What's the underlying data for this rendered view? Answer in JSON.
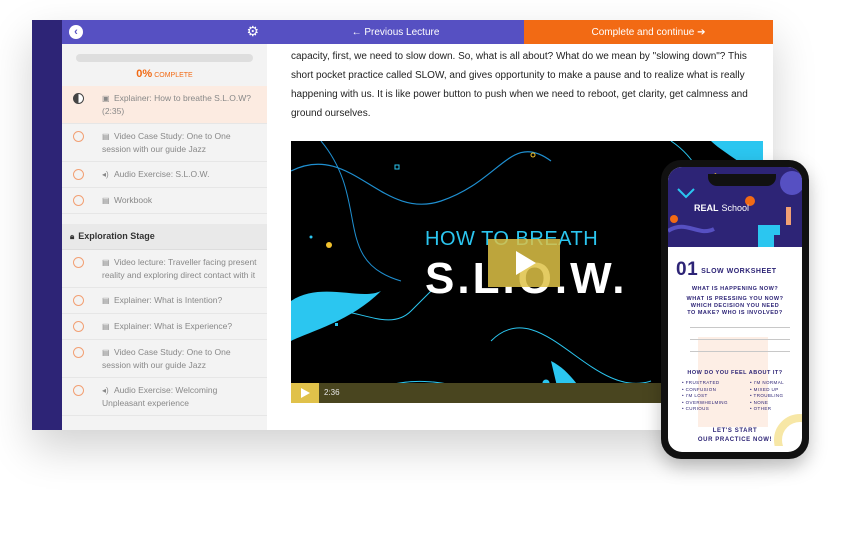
{
  "sidebar": {
    "progress_pct": "0%",
    "progress_label": "COMPLETE",
    "lessons_top": [
      {
        "icon": "video-icon",
        "label": "Explainer: How to breathe S.L.O.W? (2:35)",
        "active": true
      },
      {
        "icon": "doc-icon",
        "label": "Video Case Study: One to One session with our guide Jazz"
      },
      {
        "icon": "audio-icon",
        "label": "Audio Exercise: S.L.O.W."
      },
      {
        "icon": "doc-icon",
        "label": "Workbook"
      }
    ],
    "stage_title": "Exploration Stage",
    "lessons_stage": [
      {
        "icon": "doc-icon",
        "label": "Video lecture: Traveller facing present reality and exploring direct contact with it"
      },
      {
        "icon": "doc-icon",
        "label": "Explainer: What is Intention?"
      },
      {
        "icon": "doc-icon",
        "label": "Explainer: What is Experience?"
      },
      {
        "icon": "doc-icon",
        "label": "Video Case Study: One to One session with our guide Jazz"
      },
      {
        "icon": "audio-icon",
        "label": "Audio Exercise: Welcoming Unpleasant experience"
      }
    ]
  },
  "nav": {
    "prev_label": "← Previous Lecture",
    "next_label": "Complete and continue ➔"
  },
  "content": {
    "paragraph": "capacity, first, we need to slow down. So, what is all about? What do we mean by \"slowing down\"? This short pocket practice called SLOW, and gives opportunity to make a pause and to realize what is really happening with us. It is like power button to push when we need to reboot, get clarity, get calmness and ground ourselves."
  },
  "video": {
    "title_line1": "HOW TO BREATH",
    "title_line2": "S.L.O.W.",
    "time": "2:36"
  },
  "phone": {
    "brand_bold": "REAL",
    "brand_rest": "School",
    "number": "01",
    "sheet_title": "SLOW WORKSHEET",
    "q1": "WHAT IS HAPPENING NOW?",
    "q2": "WHAT IS PRESSING YOU NOW? WHICH DECISION YOU NEED TO MAKE? WHO IS INVOLVED?",
    "q3": "HOW DO YOU FEEL ABOUT IT?",
    "feelings_left": [
      "FRUSTRATED",
      "CONFUSION",
      "I'M LOST",
      "OVERWHELMING",
      "CURIOUS"
    ],
    "feelings_right": [
      "I'M NORMAL",
      "MIXED UP",
      "TROUBLING",
      "NONE",
      "OTHER"
    ],
    "cta_line1": "LET'S START",
    "cta_line2": "OUR PRACTICE NOW!"
  }
}
